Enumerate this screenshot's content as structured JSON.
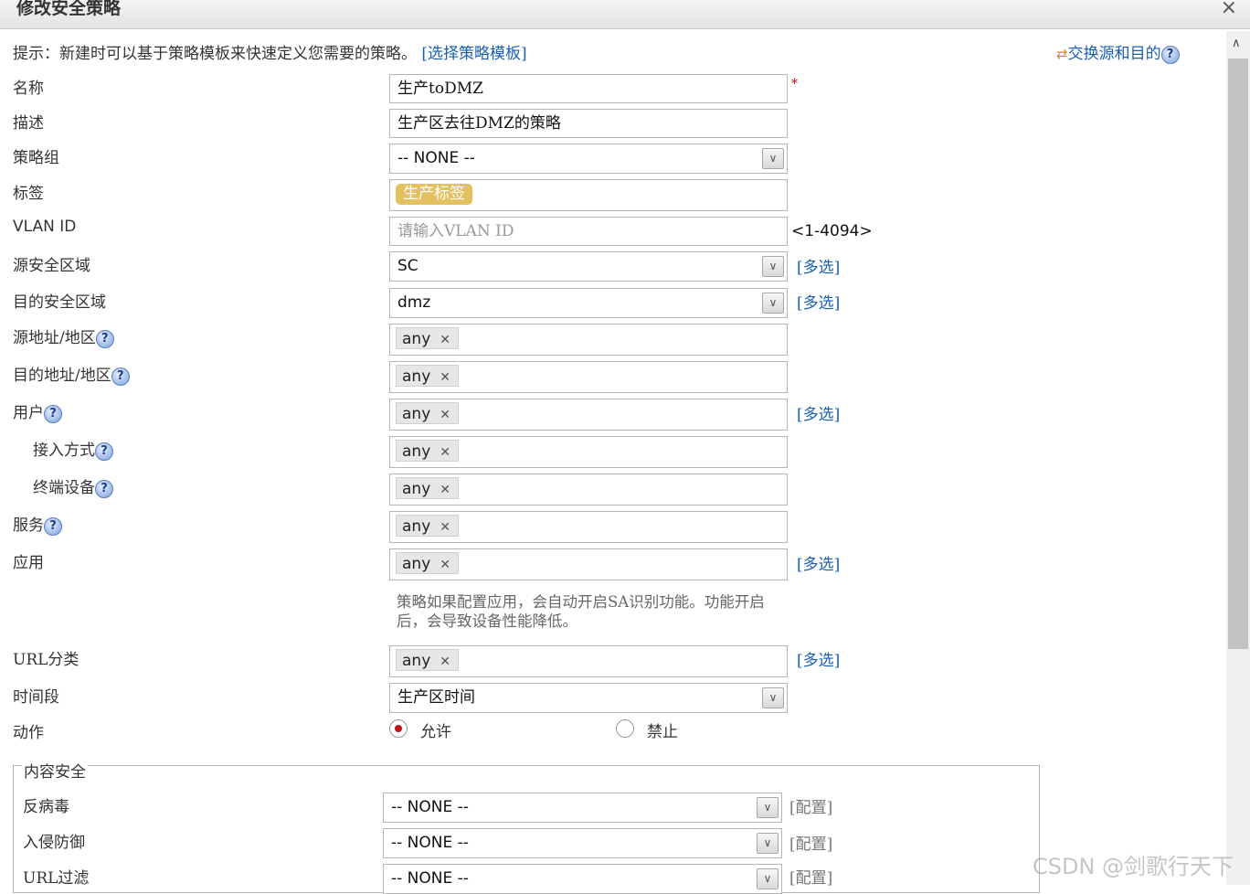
{
  "dialog": {
    "title": "修改安全策略",
    "close": "×"
  },
  "hint": {
    "text": "提示：新建时可以基于策略模板来快速定义您需要的策略。",
    "link": "[选择策略模板]"
  },
  "swap": {
    "icon": "⇄",
    "label": "交换源和目的"
  },
  "help_icon": "?",
  "form": {
    "name": {
      "label": "名称",
      "value": "生产toDMZ",
      "required": "*"
    },
    "desc": {
      "label": "描述",
      "value": "生产区去往DMZ的策略"
    },
    "group": {
      "label": "策略组",
      "value": "-- NONE --"
    },
    "tag": {
      "label": "标签",
      "chip": "生产标签"
    },
    "vlan": {
      "label": "VLAN ID",
      "placeholder": "请输入VLAN ID",
      "range": "<1-4094>"
    },
    "src_zone": {
      "label": "源安全区域",
      "value": "SC",
      "multi": "[多选]"
    },
    "dst_zone": {
      "label": "目的安全区域",
      "value": "dmz",
      "multi": "[多选]"
    },
    "src_addr": {
      "label": "源地址/地区",
      "chip": "any"
    },
    "dst_addr": {
      "label": "目的地址/地区",
      "chip": "any"
    },
    "user": {
      "label": "用户",
      "chip": "any",
      "multi": "[多选]"
    },
    "access": {
      "label": "接入方式",
      "chip": "any"
    },
    "terminal": {
      "label": "终端设备",
      "chip": "any"
    },
    "service": {
      "label": "服务",
      "chip": "any"
    },
    "app": {
      "label": "应用",
      "chip": "any",
      "multi": "[多选]"
    },
    "app_note": {
      "line1": "策略如果配置应用，会自动开启SA识别功能。功能开启",
      "line2": "后，会导致设备性能降低。"
    },
    "url_cat": {
      "label": "URL分类",
      "chip": "any",
      "multi": "[多选]"
    },
    "time": {
      "label": "时间段",
      "value": "生产区时间"
    },
    "action": {
      "label": "动作",
      "allow": "允许",
      "deny": "禁止",
      "selected": "允许"
    }
  },
  "content_security": {
    "legend": "内容安全",
    "antivirus": {
      "label": "反病毒",
      "value": "-- NONE --",
      "config": "[配置]"
    },
    "ips": {
      "label": "入侵防御",
      "value": "-- NONE --",
      "config": "[配置]"
    },
    "url_filter": {
      "label": "URL过滤",
      "value": "-- NONE --",
      "config": "[配置]"
    }
  },
  "chip_remove": "✕",
  "dropdown_arrow": "∨",
  "scroll_up": "∧",
  "watermark": "CSDN @剑歌行天下"
}
